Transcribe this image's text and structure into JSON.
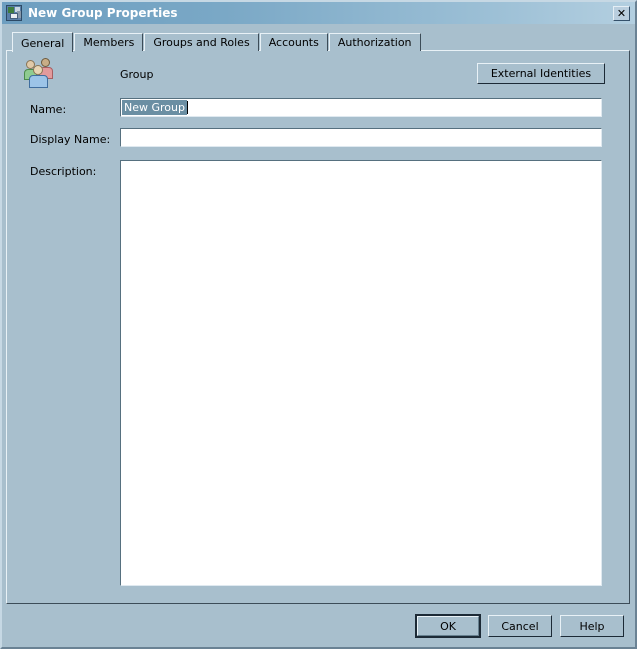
{
  "window": {
    "title": "New Group Properties",
    "icon": "group-properties-icon",
    "close_label": "✕"
  },
  "tabs": [
    {
      "label": "General",
      "active": true
    },
    {
      "label": "Members",
      "active": false
    },
    {
      "label": "Groups and Roles",
      "active": false
    },
    {
      "label": "Accounts",
      "active": false
    },
    {
      "label": "Authorization",
      "active": false
    }
  ],
  "general": {
    "object_icon": "group-users-icon",
    "object_type_label": "Group",
    "external_identities_label": "External Identities",
    "fields": {
      "name": {
        "label": "Name:",
        "value": "New Group",
        "selected": true
      },
      "display_name": {
        "label": "Display Name:",
        "value": ""
      },
      "description": {
        "label": "Description:",
        "value": ""
      }
    }
  },
  "footer": {
    "ok_label": "OK",
    "cancel_label": "Cancel",
    "help_label": "Help"
  },
  "colors": {
    "dialog_background": "#a8bfcd",
    "titlebar_start": "#6d9ec0",
    "titlebar_end": "#b3cfe0",
    "selection_background": "#6b8fa3",
    "selection_text": "#ffffff",
    "input_background": "#ffffff"
  }
}
